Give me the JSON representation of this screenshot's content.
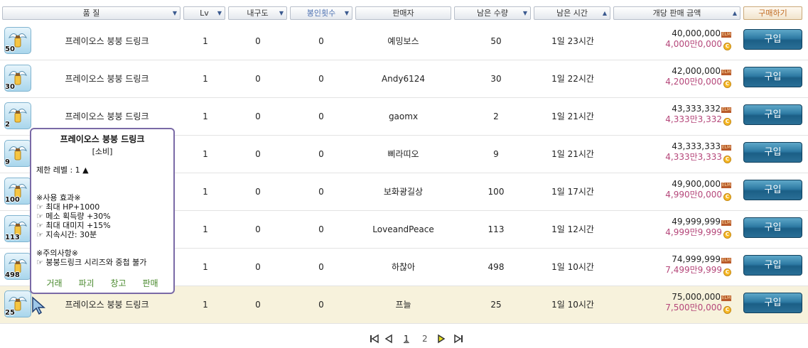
{
  "header": {
    "quality": "품 질",
    "lv": "Lv",
    "durability": "내구도",
    "seal_count": "봉인횟수",
    "seller": "판매자",
    "remaining_qty": "남은 수량",
    "remaining_time": "남은 시간",
    "unit_price": "개당 판매 금액",
    "buy": "구매하기"
  },
  "rows": [
    {
      "badge": "50",
      "name": "프레이오스 붕붕 드링크",
      "lv": "1",
      "dur": "0",
      "seal": "0",
      "seller": "예밍보스",
      "qty": "50",
      "time": "1일 23시간",
      "meso": "40,000,000",
      "cash": "4,000만0,000",
      "buy": "구입"
    },
    {
      "badge": "30",
      "name": "프레이오스 붕붕 드링크",
      "lv": "1",
      "dur": "0",
      "seal": "0",
      "seller": "Andy6124",
      "qty": "30",
      "time": "1일 22시간",
      "meso": "42,000,000",
      "cash": "4,200만0,000",
      "buy": "구입"
    },
    {
      "badge": "2",
      "name": "프레이오스 붕붕 드링크",
      "lv": "1",
      "dur": "0",
      "seal": "0",
      "seller": "gaomx",
      "qty": "2",
      "time": "1일 21시간",
      "meso": "43,333,332",
      "cash": "4,333만3,332",
      "buy": "구입"
    },
    {
      "badge": "9",
      "name": "",
      "lv": "1",
      "dur": "0",
      "seal": "0",
      "seller": "삐라띠오",
      "qty": "9",
      "time": "1일 21시간",
      "meso": "43,333,333",
      "cash": "4,333만3,333",
      "buy": "구입"
    },
    {
      "badge": "100",
      "name": "",
      "lv": "1",
      "dur": "0",
      "seal": "0",
      "seller": "보화광길상",
      "qty": "100",
      "time": "1일 17시간",
      "meso": "49,900,000",
      "cash": "4,990만0,000",
      "buy": "구입"
    },
    {
      "badge": "113",
      "name": "",
      "lv": "1",
      "dur": "0",
      "seal": "0",
      "seller": "LoveandPeace",
      "qty": "113",
      "time": "1일 12시간",
      "meso": "49,999,999",
      "cash": "4,999만9,999",
      "buy": "구입"
    },
    {
      "badge": "498",
      "name": "",
      "lv": "1",
      "dur": "0",
      "seal": "0",
      "seller": "하찮아",
      "qty": "498",
      "time": "1일 10시간",
      "meso": "74,999,999",
      "cash": "7,499만9,999",
      "buy": "구입"
    },
    {
      "badge": "25",
      "name": "프레이오스 붕붕 드링크",
      "lv": "1",
      "dur": "0",
      "seal": "0",
      "seller": "프늘",
      "qty": "25",
      "time": "1일 10시간",
      "meso": "75,000,000",
      "cash": "7,500만0,000",
      "buy": "구입"
    }
  ],
  "tooltip": {
    "title": "프레이오스 붕붕 드링크",
    "type": "[소비]",
    "level_req": "제한 레벨 : 1 ▲",
    "effect_header": "※사용 효과※",
    "effects": [
      "☞ 최대 HP+1000",
      "☞ 메소 획득량 +30%",
      "☞ 최대 대미지 +15%",
      "☞ 지속시간: 30분"
    ],
    "caution_header": "※주의사항※",
    "caution": "☞ 붕붕드링크 시리즈와 중첩 불가",
    "actions": [
      "거래",
      "파괴",
      "창고",
      "판매"
    ]
  },
  "pagination": {
    "pages": [
      "1",
      "2"
    ],
    "current": "1"
  },
  "icons": {
    "meso": "ELM",
    "cash": "C"
  },
  "colors": {
    "buy_button": "#2d7aa3",
    "cash_price": "#b5477a",
    "tooltip_border": "#7a6aa6",
    "highlight_row": "#f7f2dc"
  }
}
